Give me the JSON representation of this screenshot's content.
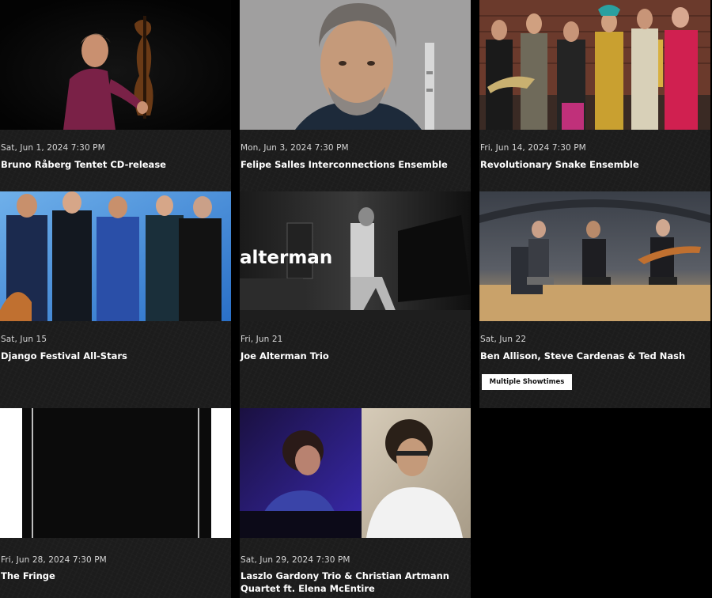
{
  "events": [
    {
      "date": "Sat, Jun 1, 2024 7:30 PM",
      "title": "Bruno Råberg Tentet CD-release"
    },
    {
      "date": "Mon, Jun 3, 2024 7:30 PM",
      "title": "Felipe Salles Interconnections Ensemble"
    },
    {
      "date": "Fri, Jun 14, 2024 7:30 PM",
      "title": "Revolutionary Snake Ensemble"
    },
    {
      "date": "Sat, Jun 15",
      "title": "Django Festival All-Stars"
    },
    {
      "date": "Fri, Jun 21",
      "title": "Joe Alterman Trio",
      "image_text": "alterman"
    },
    {
      "date": "Sat, Jun 22",
      "title": "Ben Allison, Steve Cardenas & Ted Nash",
      "button": "Multiple Showtimes"
    },
    {
      "date": "Fri, Jun 28, 2024 7:30 PM",
      "title": "The Fringe"
    },
    {
      "date": "Sat, Jun 29, 2024 7:30 PM",
      "title": "Laszlo Gardony Trio & Christian Artmann Quartet ft. Elena McEntire"
    }
  ]
}
